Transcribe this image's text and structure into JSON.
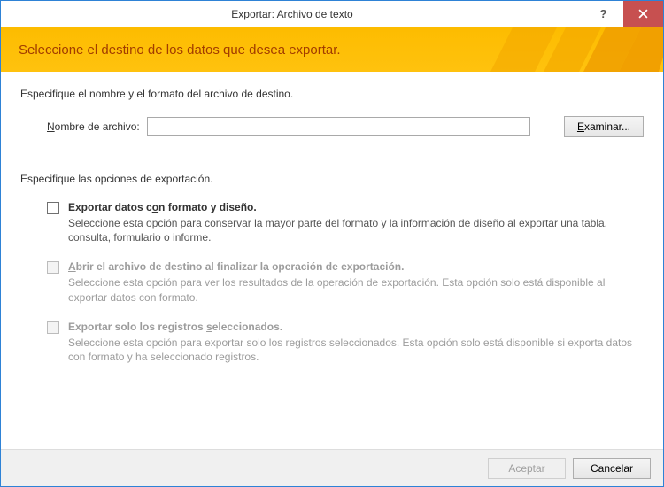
{
  "titlebar": {
    "title": "Exportar: Archivo de texto",
    "help": "?",
    "close": "✕"
  },
  "banner": {
    "title": "Seleccione el destino de los datos que desea exportar."
  },
  "destination": {
    "section_label": "Especifique el nombre y el formato del archivo de destino.",
    "filename_label_pre": "N",
    "filename_label_post": "ombre de archivo:",
    "filename_value": "",
    "browse_pre": "E",
    "browse_post": "xaminar..."
  },
  "options": {
    "section_label": "Especifique las opciones de exportación.",
    "items": [
      {
        "title_pre": "Exportar datos c",
        "title_ul": "o",
        "title_post": "n formato y diseño.",
        "desc": "Seleccione esta opción para conservar la mayor parte del formato y la información de diseño al exportar una tabla, consulta, formulario o informe.",
        "enabled": true
      },
      {
        "title_pre": "",
        "title_ul": "A",
        "title_post": "brir el archivo de destino al finalizar la operación de exportación.",
        "desc": "Seleccione esta opción para ver los resultados de la operación de exportación. Esta opción solo está disponible al exportar datos con formato.",
        "enabled": false
      },
      {
        "title_pre": "Exportar solo los registros ",
        "title_ul": "s",
        "title_post": "eleccionados.",
        "desc": "Seleccione esta opción para exportar solo los registros seleccionados. Esta opción solo está disponible si exporta datos con formato y ha seleccionado registros.",
        "enabled": false
      }
    ]
  },
  "footer": {
    "accept": "Aceptar",
    "cancel": "Cancelar"
  }
}
